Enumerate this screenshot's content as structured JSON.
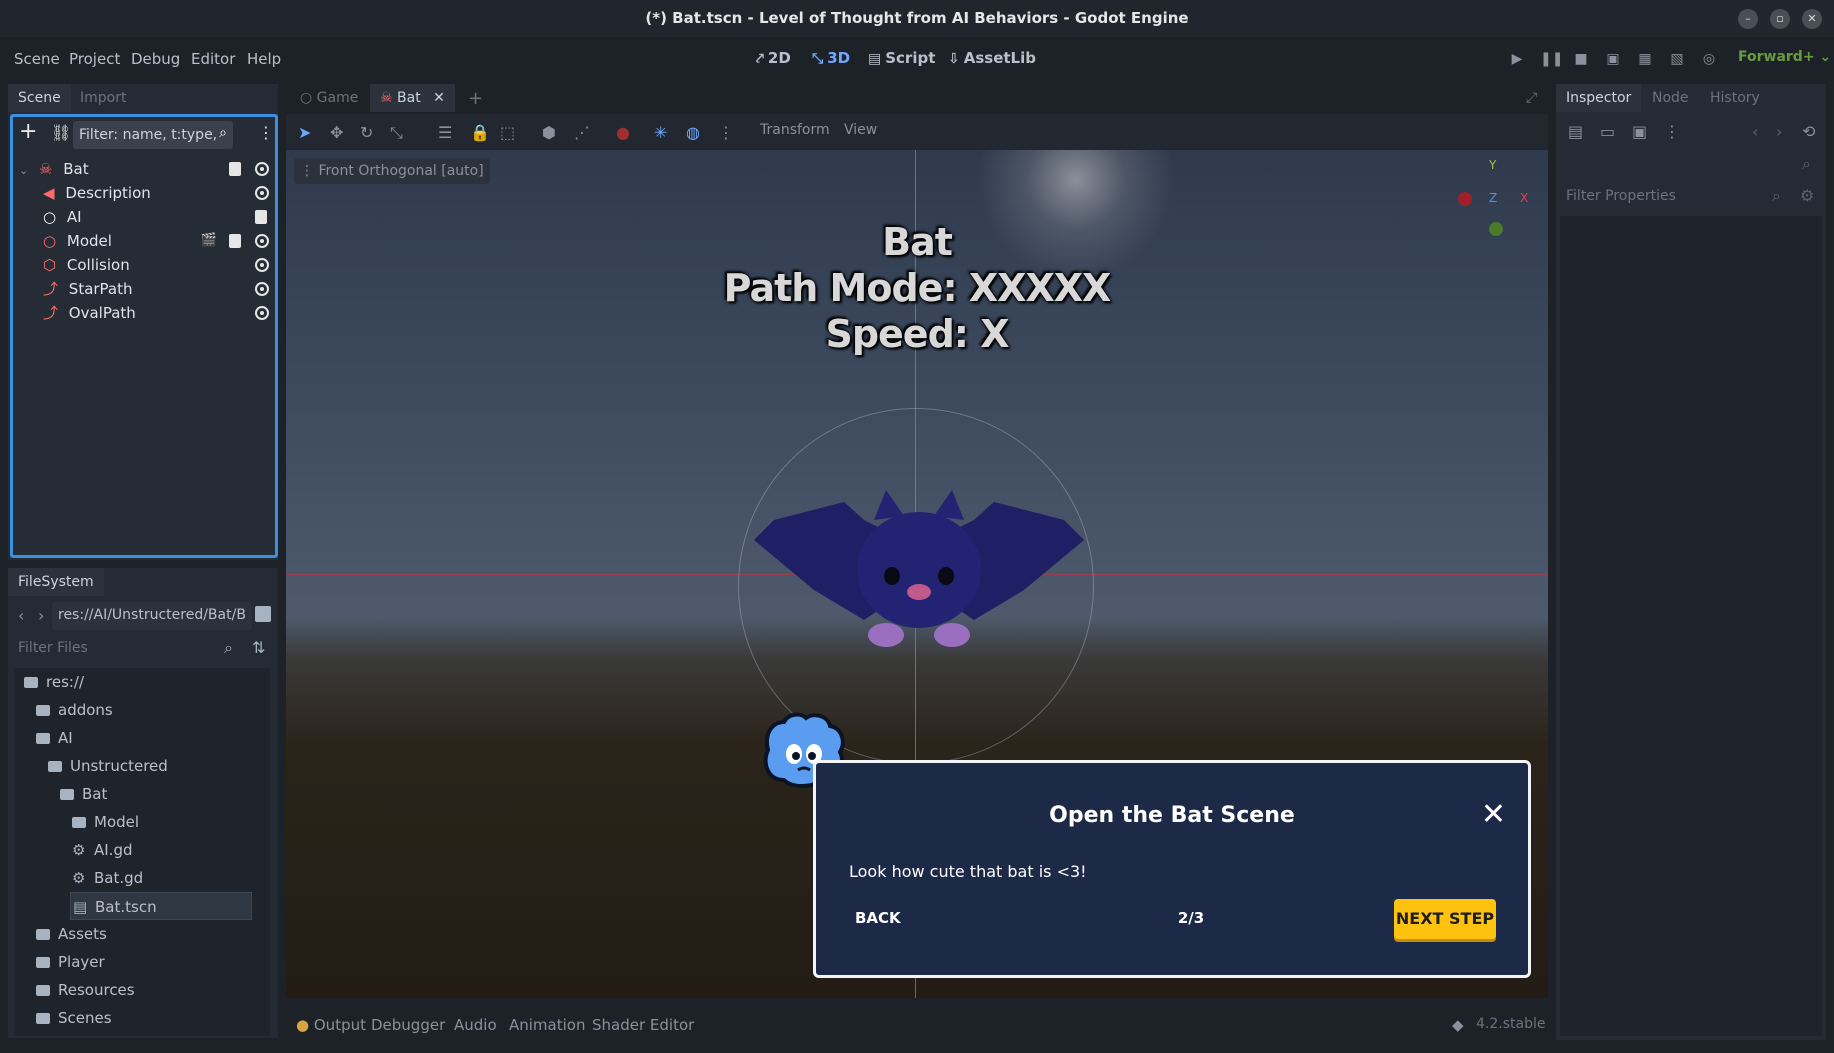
{
  "window": {
    "title": "(*) Bat.tscn - Level of Thought from AI Behaviors - Godot Engine"
  },
  "menu": [
    "Scene",
    "Project",
    "Debug",
    "Editor",
    "Help"
  ],
  "workspaces": {
    "w2d": "2D",
    "w3d": "3D",
    "script": "Script",
    "assetlib": "AssetLib"
  },
  "renderer": "Forward+",
  "scene_dock": {
    "tabs": [
      "Scene",
      "Import"
    ],
    "filter_placeholder": "Filter: name, t:type,",
    "nodes": [
      {
        "label": "Bat",
        "icon": "bat-icon"
      },
      {
        "label": "Description",
        "icon": "label3d-icon"
      },
      {
        "label": "AI",
        "icon": "node-icon"
      },
      {
        "label": "Model",
        "icon": "node3d-icon"
      },
      {
        "label": "Collision",
        "icon": "collision-shape-icon"
      },
      {
        "label": "StarPath",
        "icon": "path-icon"
      },
      {
        "label": "OvalPath",
        "icon": "path-icon"
      }
    ]
  },
  "filesystem": {
    "tab": "FileSystem",
    "path": "res://AI/Unstructered/Bat/B",
    "filter_placeholder": "Filter Files",
    "items": [
      {
        "label": "res://",
        "type": "folder"
      },
      {
        "label": "addons",
        "type": "folder"
      },
      {
        "label": "AI",
        "type": "folder"
      },
      {
        "label": "Unstructered",
        "type": "folder"
      },
      {
        "label": "Bat",
        "type": "folder"
      },
      {
        "label": "Model",
        "type": "folder"
      },
      {
        "label": "AI.gd",
        "type": "script"
      },
      {
        "label": "Bat.gd",
        "type": "script"
      },
      {
        "label": "Bat.tscn",
        "type": "scene"
      },
      {
        "label": "Assets",
        "type": "folder"
      },
      {
        "label": "Player",
        "type": "folder"
      },
      {
        "label": "Resources",
        "type": "folder"
      },
      {
        "label": "Scenes",
        "type": "folder"
      }
    ]
  },
  "editor_tabs": {
    "game": "Game",
    "bat": "Bat"
  },
  "viewport_toolbar": {
    "transform": "Transform",
    "view": "View"
  },
  "viewport": {
    "label": "Front Orthogonal [auto]",
    "gizmo": {
      "y": "Y",
      "z": "Z",
      "x": "X"
    },
    "text_lines": [
      "Bat",
      "Path Mode: XXXXX",
      "Speed: X"
    ]
  },
  "tutorial": {
    "title": "Open the Bat Scene",
    "body": "Look how cute that bat is <3!",
    "back": "BACK",
    "page": "2/3",
    "next": "NEXT STEP"
  },
  "bottom_tabs": [
    "Output",
    "Debugger",
    "Audio",
    "Animation",
    "Shader Editor"
  ],
  "version": "4.2.stable",
  "inspector": {
    "tabs": [
      "Inspector",
      "Node",
      "History"
    ],
    "filter_placeholder": "Filter Properties"
  },
  "colors": {
    "accent": "#6fa7ff",
    "dialog_bg": "#1d2a47",
    "next_button": "#ffc20e"
  }
}
